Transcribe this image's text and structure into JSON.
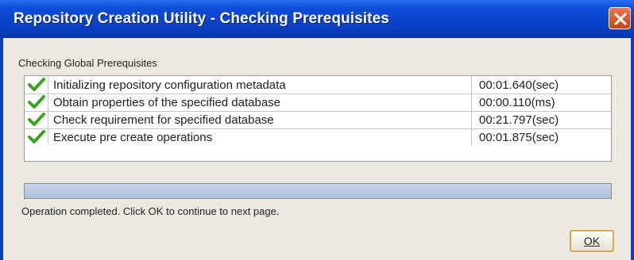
{
  "window": {
    "title": "Repository Creation Utility - Checking Prerequisites"
  },
  "group_label": "Checking Global Prerequisites",
  "prerequisites": [
    {
      "status_icon": "check-icon",
      "description": "Initializing repository configuration metadata",
      "time": "00:01.640(sec)"
    },
    {
      "status_icon": "check-icon",
      "description": "Obtain properties of the specified database",
      "time": "00:00.110(ms)"
    },
    {
      "status_icon": "check-icon",
      "description": "Check requirement for specified database",
      "time": "00:21.797(sec)"
    },
    {
      "status_icon": "check-icon",
      "description": "Execute pre create operations",
      "time": "00:01.875(sec)"
    }
  ],
  "progress": {
    "fraction": 1.0
  },
  "status_message": "Operation completed. Click OK to continue to next page.",
  "buttons": {
    "ok_label": "OK"
  },
  "colors": {
    "title_bar": "#0a3fc4",
    "dialog_background": "#eceae0",
    "check_green": "#3aa321",
    "close_button": "#d9562a"
  }
}
